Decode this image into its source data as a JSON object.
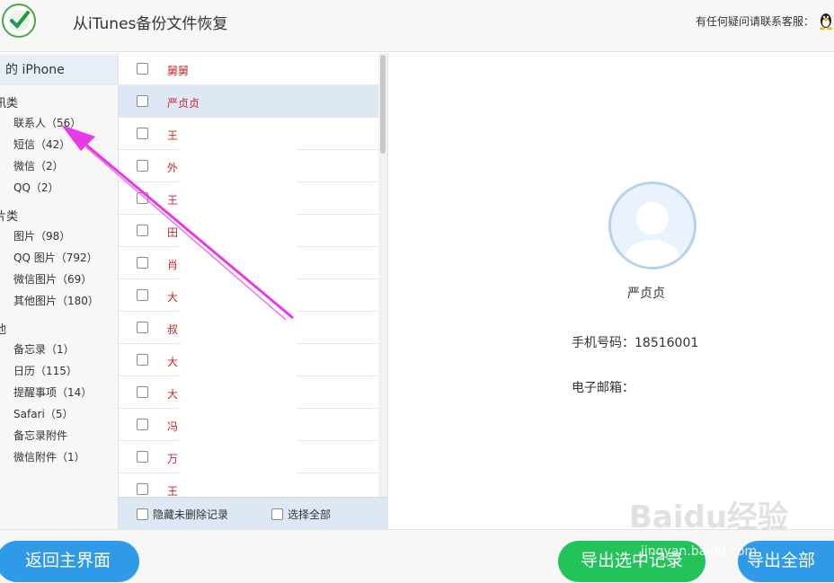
{
  "header": {
    "title": "从iTunes备份文件恢复",
    "support_text": "有任何疑问请联系客服："
  },
  "sidebar": {
    "device": "的 iPhone",
    "groups": [
      {
        "title": "讯类",
        "items": [
          "联系人（56）",
          "短信（42）",
          "微信（2）",
          "QQ（2）"
        ]
      },
      {
        "title": "片类",
        "items": [
          "图片（98）",
          "QQ 图片（792）",
          "微信图片（69）",
          "其他图片（180）"
        ]
      },
      {
        "title": "他",
        "items": [
          "备忘录（1）",
          "日历（115）",
          "提醒事项（14）",
          "Safari（5）",
          "备忘录附件",
          "微信附件（1）"
        ]
      }
    ]
  },
  "list": {
    "rows": [
      "舅舅",
      "严贞贞",
      "王",
      "外",
      "王",
      "田",
      "肖",
      "大",
      "叔",
      "大",
      "大",
      "冯",
      "万",
      "王"
    ],
    "hide_deleted_label": "隐藏未删除记录",
    "select_all_label": "选择全部"
  },
  "detail": {
    "name": "严贞贞",
    "phone_line": "手机号码：18516001",
    "email_line": "电子邮箱："
  },
  "buttons": {
    "back": "返回主界面",
    "export_selected": "导出选中记录",
    "export_all": "导出全部"
  },
  "watermark": {
    "main": "Baidu经验",
    "sub": "jingyan.baidu.com"
  },
  "colors": {
    "accent_blue": "#2f9be8",
    "accent_green": "#22c45a",
    "contact_red": "#c8262c",
    "annotation_arrow": "#e63ae6"
  }
}
